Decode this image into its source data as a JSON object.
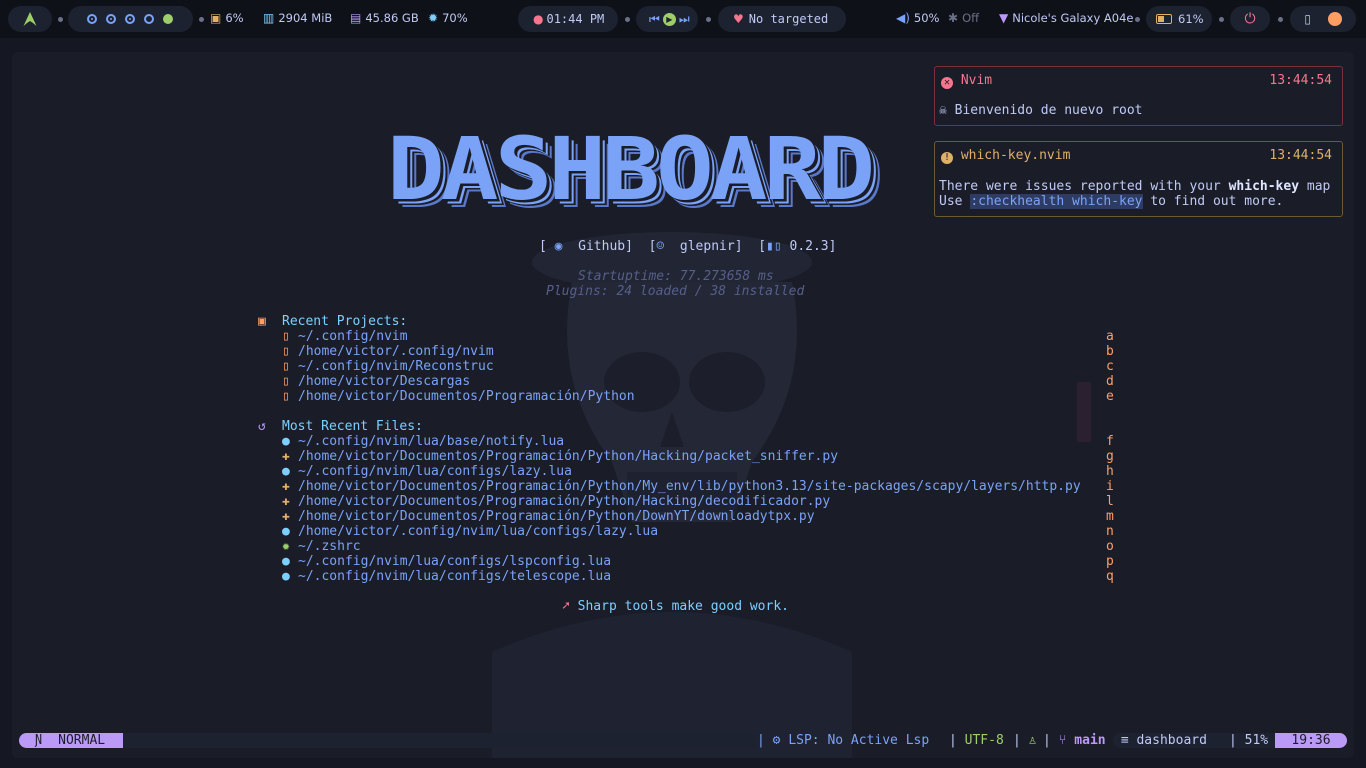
{
  "topbar": {
    "distro_icon": "arch-icon",
    "cpu": "6%",
    "ram": "2904 MiB",
    "disk": "45.86 GB",
    "temp": "70%",
    "clock": "01:44 PM",
    "media_status": "No targeted",
    "volume": "50%",
    "bluetooth": "Off",
    "wifi": "Nicole's Galaxy A04e",
    "battery": "61%",
    "colors": {
      "accent": "#7aa2f7",
      "green": "#9ece6a",
      "red": "#f7768e"
    }
  },
  "dashboard": {
    "banner": "DASHBOARD",
    "link_github": "Github",
    "link_user": "glepnir",
    "link_version": "0.2.3",
    "startuptime": "Startuptime: 77.273658 ms",
    "plugins": "Plugins: 24 loaded / 38 installed",
    "recent_projects_title": "Recent Projects:",
    "projects": [
      {
        "path": "~/.config/nvim",
        "key": "a"
      },
      {
        "path": "/home/victor/.config/nvim",
        "key": "b"
      },
      {
        "path": "~/.config/nvim/Reconstruc",
        "key": "c"
      },
      {
        "path": "/home/victor/Descargas",
        "key": "d"
      },
      {
        "path": "/home/victor/Documentos/Programación/Python",
        "key": "e"
      }
    ],
    "recent_files_title": "Most Recent Files:",
    "files": [
      {
        "icon": "lua-icon",
        "path": "~/.config/nvim/lua/base/notify.lua",
        "key": "f"
      },
      {
        "icon": "python-icon",
        "path": "/home/victor/Documentos/Programación/Python/Hacking/packet_sniffer.py",
        "key": "g"
      },
      {
        "icon": "lua-icon",
        "path": "~/.config/nvim/lua/configs/lazy.lua",
        "key": "h"
      },
      {
        "icon": "python-icon",
        "path": "/home/victor/Documentos/Programación/Python/My_env/lib/python3.13/site-packages/scapy/layers/http.py",
        "key": "i"
      },
      {
        "icon": "python-icon",
        "path": "/home/victor/Documentos/Programación/Python/Hacking/decodificador.py",
        "key": "l"
      },
      {
        "icon": "python-icon",
        "path": "/home/victor/Documentos/Programación/Python/DownYT/downloadytpx.py",
        "key": "m"
      },
      {
        "icon": "lua-icon",
        "path": "/home/victor/.config/nvim/lua/configs/lazy.lua",
        "key": "n"
      },
      {
        "icon": "gear-icon",
        "path": "~/.zshrc",
        "key": "o"
      },
      {
        "icon": "lua-icon",
        "path": "~/.config/nvim/lua/configs/lspconfig.lua",
        "key": "p"
      },
      {
        "icon": "lua-icon",
        "path": "~/.config/nvim/lua/configs/telescope.lua",
        "key": "q"
      }
    ],
    "footer": "Sharp tools make good work."
  },
  "notifications": [
    {
      "title": "Nvim",
      "time": "13:44:54",
      "body": "Bienvenido de nuevo root"
    },
    {
      "title": "which-key.nvim",
      "time": "13:44:54",
      "line1_a": "There were issues reported with your ",
      "line1_b": "which-key",
      "line1_c": " map",
      "line2_a": "Use ",
      "line2_b": ":checkhealth which-key",
      "line2_c": " to find out more."
    }
  ],
  "statusline": {
    "mode": "NORMAL",
    "lsp": "LSP: No Active Lsp",
    "encoding": "UTF-8",
    "branch": "main",
    "filetype": "dashboard",
    "percent": "51%",
    "position": "19:36"
  }
}
